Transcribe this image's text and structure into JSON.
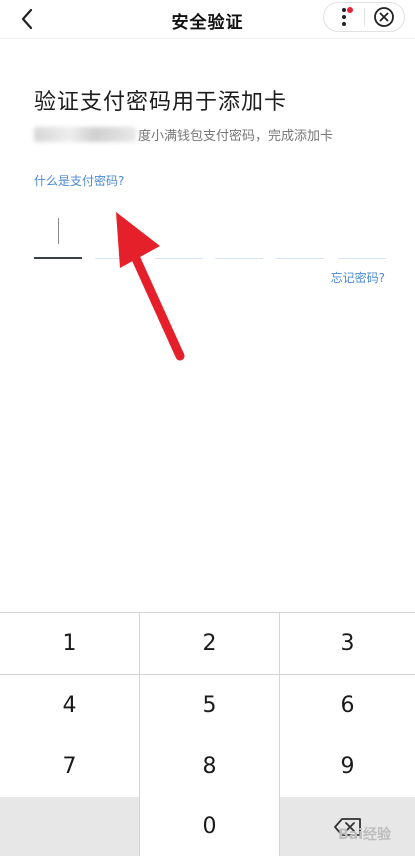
{
  "nav": {
    "title": "安全验证",
    "back_icon": "chevron-left-icon",
    "more_icon": "more-vertical-icon",
    "close_icon": "close-circle-icon",
    "badge_color": "#e6243c"
  },
  "main": {
    "heading": "验证支付密码用于添加卡",
    "subtitle": "度小满钱包支付密码，完成添加卡",
    "what_is_link": "什么是支付密码?",
    "forgot_link": "忘记密码?",
    "pin_length": 6,
    "pin_filled": 0,
    "link_color": "#4a8ad7"
  },
  "annotation": {
    "color": "#e5202a",
    "icon": "red-arrow-icon"
  },
  "keypad": {
    "keys": [
      "1",
      "2",
      "3",
      "4",
      "5",
      "6",
      "7",
      "8",
      "9",
      "",
      "0",
      "delete"
    ],
    "delete_icon": "backspace-icon"
  },
  "watermark": {
    "text": "Bai经验"
  }
}
